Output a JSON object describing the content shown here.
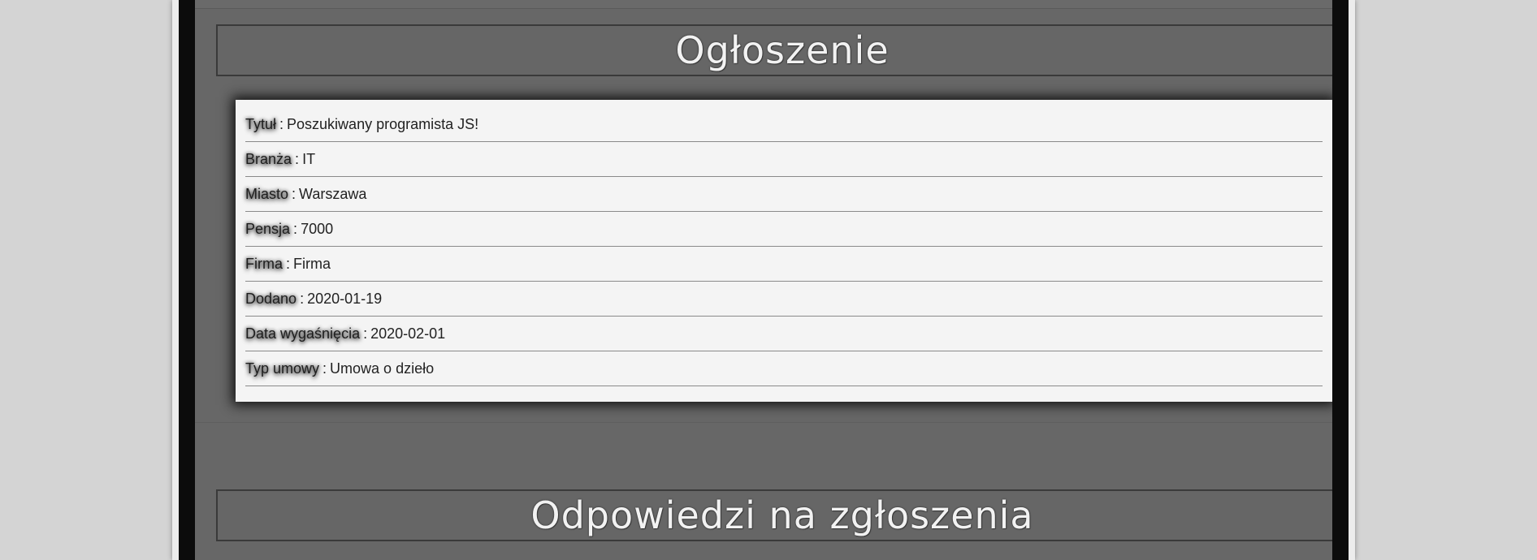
{
  "section_ad": {
    "title": "Ogłoszenie"
  },
  "section_responses": {
    "title": "Odpowiedzi na zgłoszenia"
  },
  "ad_details": {
    "separator": ":",
    "rows": [
      {
        "label": "Tytuł",
        "value": "Poszukiwany programista JS!"
      },
      {
        "label": "Branża",
        "value": "IT"
      },
      {
        "label": "Miasto",
        "value": "Warszawa"
      },
      {
        "label": "Pensja",
        "value": "7000"
      },
      {
        "label": "Firma",
        "value": "Firma"
      },
      {
        "label": "Dodano",
        "value": "2020-01-19"
      },
      {
        "label": "Data wygaśnięcia",
        "value": "2020-02-01"
      },
      {
        "label": "Typ umowy",
        "value": "Umowa o dzieło"
      }
    ]
  }
}
